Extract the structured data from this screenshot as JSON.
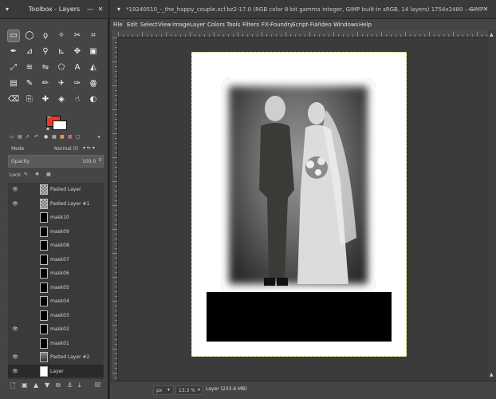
{
  "toolbox": {
    "title": "Toolbox - Layers",
    "tools": [
      "rect-select-icon",
      "ellipse-select-icon",
      "free-select-icon",
      "fuzzy-select-icon",
      "scissors-icon",
      "crop-icon",
      "path-icon",
      "color-picker-icon",
      "zoom-icon",
      "measure-icon",
      "move-icon",
      "align-icon",
      "transform-icon",
      "warp-icon",
      "flip-icon",
      "cage-icon",
      "text-icon",
      "bucket-fill-icon",
      "gradient-icon",
      "paintbrush-icon",
      "pencil-icon",
      "airbrush-icon",
      "ink-icon",
      "mypaint-icon",
      "eraser-icon",
      "clone-icon",
      "heal-icon",
      "perspective-clone-icon",
      "smudge-icon",
      "dodge-burn-icon"
    ],
    "foreground_color": "#e83a2c",
    "background_color": "#ffffff"
  },
  "layers": {
    "mode_label": "Mode",
    "mode_value": "Normal (l)",
    "opacity_label": "Opacity",
    "opacity_value": "100.0",
    "lock_label": "Lock:",
    "items": [
      {
        "name": "Pasted Layer",
        "visible": true,
        "thumb": "checker"
      },
      {
        "name": "Pasted Layer #1",
        "visible": true,
        "thumb": "checker"
      },
      {
        "name": "mask10",
        "visible": false,
        "thumb": "mask"
      },
      {
        "name": "mask09",
        "visible": false,
        "thumb": "mask"
      },
      {
        "name": "mask08",
        "visible": false,
        "thumb": "mask"
      },
      {
        "name": "mask07",
        "visible": false,
        "thumb": "mask"
      },
      {
        "name": "mask06",
        "visible": false,
        "thumb": "mask"
      },
      {
        "name": "mask05",
        "visible": false,
        "thumb": "mask"
      },
      {
        "name": "mask04",
        "visible": false,
        "thumb": "mask"
      },
      {
        "name": "mask03",
        "visible": false,
        "thumb": "mask"
      },
      {
        "name": "mask02",
        "visible": true,
        "thumb": "mask"
      },
      {
        "name": "mask01",
        "visible": false,
        "thumb": "mask"
      },
      {
        "name": "Pasted Layer #2",
        "visible": true,
        "thumb": "photo"
      },
      {
        "name": "Layer",
        "visible": true,
        "thumb": "white"
      }
    ]
  },
  "image_window": {
    "title": "*19240510_-_the_happy_couple.xcf.bz2-17.0 (RGB color 8-bit gamma integer, GIMP built-in sRGB, 14 layers) 1754x2480 – GIMP",
    "menu": [
      "File",
      "Edit",
      "Select",
      "View",
      "Image",
      "Layer",
      "Colors",
      "Tools",
      "Filters",
      "FX-Foundry",
      "Script-Fu",
      "Video",
      "Windows",
      "Help"
    ],
    "status": {
      "unit": "px",
      "zoom": "13.3 %",
      "message": "Layer (233.6 MB)"
    }
  }
}
